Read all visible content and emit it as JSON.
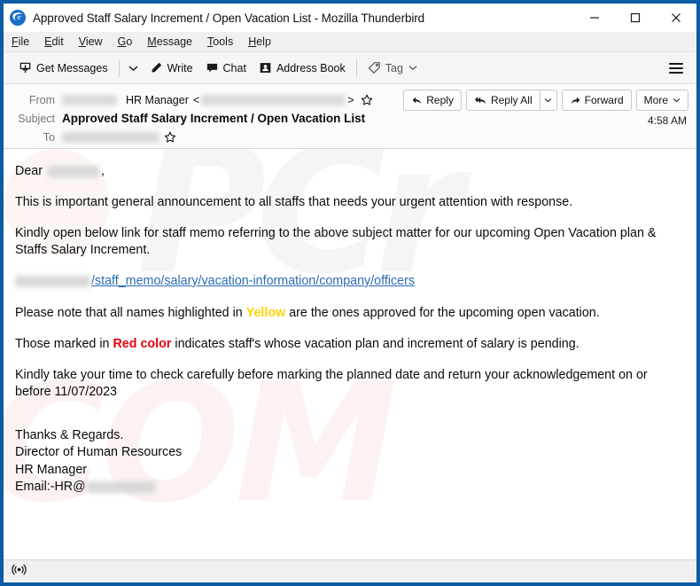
{
  "window": {
    "title": "Approved Staff Salary Increment / Open Vacation List - Mozilla Thunderbird",
    "app_icon": "thunderbird-logo-icon",
    "border_color": "#0c5ba4",
    "controls": {
      "minimize": "minimize-icon",
      "maximize": "maximize-icon",
      "close": "close-icon"
    }
  },
  "menubar": {
    "items": [
      {
        "label": "File",
        "accel": "F"
      },
      {
        "label": "Edit",
        "accel": "E"
      },
      {
        "label": "View",
        "accel": "V"
      },
      {
        "label": "Go",
        "accel": "G"
      },
      {
        "label": "Message",
        "accel": "M"
      },
      {
        "label": "Tools",
        "accel": "T"
      },
      {
        "label": "Help",
        "accel": "H"
      }
    ]
  },
  "toolbar": {
    "get_messages_label": "Get Messages",
    "get_messages_icon": "download-inbox-icon",
    "get_messages_caret": "chevron-down-icon",
    "write_label": "Write",
    "write_icon": "pencil-icon",
    "chat_label": "Chat",
    "chat_icon": "speech-bubble-icon",
    "address_book_label": "Address Book",
    "address_book_icon": "contact-card-icon",
    "tag_label": "Tag",
    "tag_icon": "tag-icon",
    "tag_caret": "chevron-down-icon",
    "app_menu_icon": "hamburger-menu-icon"
  },
  "message_header": {
    "from_label": "From",
    "from_display_name": "HR Manager",
    "from_address_redacted": true,
    "from_prefix_redacted": true,
    "subject_label": "Subject",
    "subject": "Approved Staff Salary Increment / Open Vacation List",
    "to_label": "To",
    "to_redacted": true,
    "time": "4:58 AM",
    "star_icon": "star-outline-icon",
    "actions": {
      "reply_label": "Reply",
      "reply_icon": "reply-arrow-icon",
      "reply_all_label": "Reply All",
      "reply_all_icon": "reply-all-arrow-icon",
      "reply_all_caret": "chevron-down-icon",
      "forward_label": "Forward",
      "forward_icon": "forward-arrow-icon",
      "more_label": "More",
      "more_caret": "chevron-down-icon"
    }
  },
  "body": {
    "greeting_prefix": "Dear",
    "greeting_name_redacted": true,
    "greeting_suffix": ",",
    "paragraph_1": "This is important general announcement to all staffs that needs your urgent attention with response.",
    "paragraph_2": "Kindly open below link for staff memo referring to the above subject matter for our upcoming Open Vacation plan & Staffs Salary Increment.",
    "link_domain_redacted": true,
    "link_path": "/staff_memo/salary/vacation-information/company/officers",
    "link_color": "#2b6bb5",
    "paragraph_3_before": "Please note that all names highlighted in",
    "paragraph_3_highlight": "Yellow",
    "paragraph_3_highlight_color": "#ffd400",
    "paragraph_3_after": "are the ones approved for the upcoming open vacation.",
    "paragraph_4_before": "Those marked in",
    "paragraph_4_highlight": "Red color",
    "paragraph_4_highlight_color": "#e8000c",
    "paragraph_4_after": "indicates staff's whose vacation plan and increment of salary is pending.",
    "paragraph_5": "Kindly take your time to check carefully before marking the planned date and return your acknowledgement on or before 11/07/2023",
    "signature": {
      "line_1": "Thanks & Regards.",
      "line_2": "Director of Human Resources",
      "line_3": "HR Manager",
      "line_4_prefix": "Email:-HR@",
      "line_4_domain_redacted": true
    },
    "watermark_1": "PCr",
    "watermark_2": "COM"
  },
  "statusbar": {
    "icon": "broadcast-signal-icon",
    "text": ""
  }
}
